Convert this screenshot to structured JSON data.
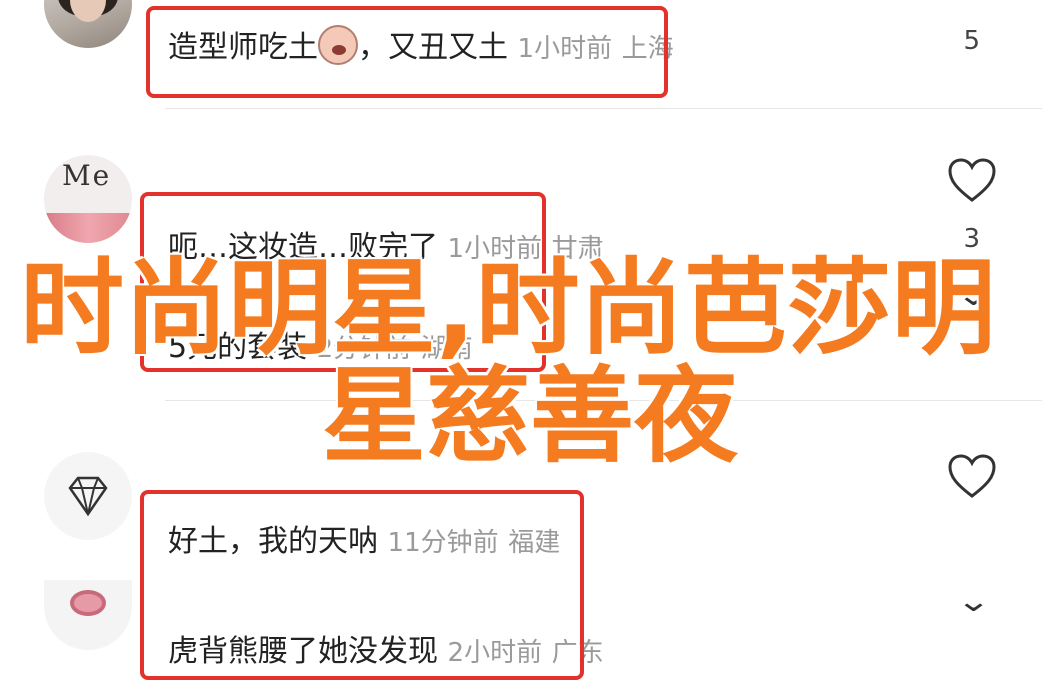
{
  "comments": [
    {
      "text": "造型师吃土",
      "suffix": "，又丑又土",
      "time": "1小时前",
      "location": "上海",
      "likes": "5"
    },
    {
      "text": "呃…这妆造…败完了",
      "time": "1小时前",
      "location": "甘肃",
      "likes": "3"
    },
    {
      "text": "5元的套装",
      "time": "2分钟前",
      "location": "湖南"
    },
    {
      "text": "好土，我的天呐",
      "time": "11分钟前",
      "location": "福建"
    },
    {
      "text": "虎背熊腰了她没发现",
      "time": "2小时前",
      "location": "广东"
    }
  ],
  "overlay": {
    "line1": "时尚明星,时尚芭莎明",
    "line2": "星慈善夜"
  },
  "colors": {
    "highlight": "#e3312b",
    "overlay": "#f47b20"
  }
}
